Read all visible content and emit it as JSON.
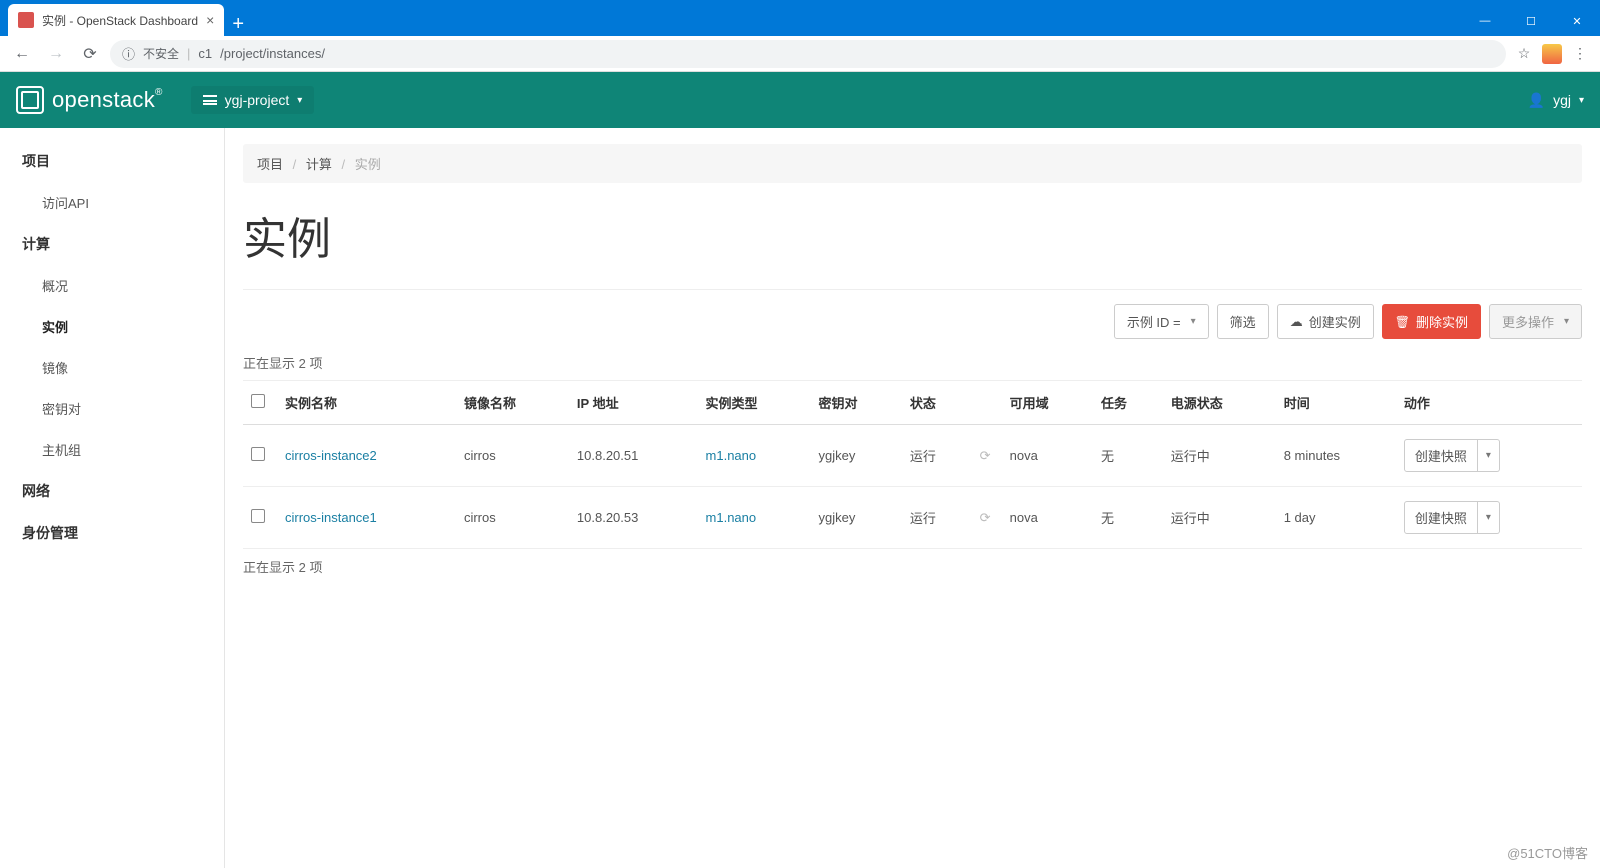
{
  "browser": {
    "tab_title": "实例 - OpenStack Dashboard",
    "url_security": "不安全",
    "url_host": "c1",
    "url_path": "/project/instances/"
  },
  "header": {
    "brand": "openstack",
    "project": "ygj-project",
    "user": "ygj"
  },
  "sidebar": {
    "project": "项目",
    "api": "访问API",
    "compute": "计算",
    "overview": "概况",
    "instances": "实例",
    "images": "镜像",
    "keypairs": "密钥对",
    "hostgroups": "主机组",
    "network": "网络",
    "identity": "身份管理"
  },
  "breadcrumb": {
    "a": "项目",
    "b": "计算",
    "c": "实例"
  },
  "page": {
    "title": "实例"
  },
  "toolbar": {
    "filter_field": "示例 ID = ",
    "filter_btn": "筛选",
    "create": "创建实例",
    "delete": "删除实例",
    "more": "更多操作"
  },
  "count": {
    "top": "正在显示 2 项",
    "bottom": "正在显示 2 项"
  },
  "columns": {
    "name": "实例名称",
    "image": "镜像名称",
    "ip": "IP 地址",
    "flavor": "实例类型",
    "keypair": "密钥对",
    "status": "状态",
    "az": "可用域",
    "task": "任务",
    "power": "电源状态",
    "time": "时间",
    "actions": "动作"
  },
  "rows": [
    {
      "name": "cirros-instance2",
      "image": "cirros",
      "ip": "10.8.20.51",
      "flavor": "m1.nano",
      "keypair": "ygjkey",
      "status": "运行",
      "az": "nova",
      "task": "无",
      "power": "运行中",
      "time": "8 minutes",
      "action": "创建快照"
    },
    {
      "name": "cirros-instance1",
      "image": "cirros",
      "ip": "10.8.20.53",
      "flavor": "m1.nano",
      "keypair": "ygjkey",
      "status": "运行",
      "az": "nova",
      "task": "无",
      "power": "运行中",
      "time": "1 day",
      "action": "创建快照"
    }
  ],
  "watermark": "@51CTO博客"
}
